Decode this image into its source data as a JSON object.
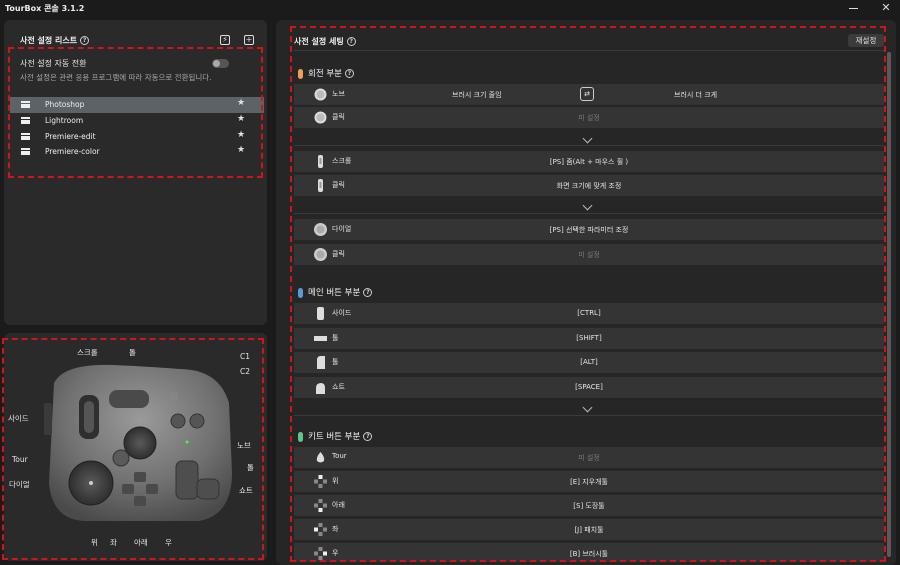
{
  "window": {
    "title": "TourBox 콘솔 3.1.2"
  },
  "presets": {
    "title": "사전 설정 리스트",
    "auto_switch_label": "사전 설정 자동 전환",
    "auto_switch_desc": "사전 설정은 관련 응용 프로그램에 따라 자동으로 전환됩니다.",
    "auto_switch_on": false,
    "items": [
      {
        "name": "Photoshop",
        "selected": true
      },
      {
        "name": "Lightroom",
        "selected": false
      },
      {
        "name": "Premiere-edit",
        "selected": false
      },
      {
        "name": "Premiere-color",
        "selected": false
      }
    ]
  },
  "device_labels": {
    "scroll": "스크롤",
    "tall": "톨",
    "c1": "C1",
    "c2": "C2",
    "side": "사이드",
    "knob": "노브",
    "tour": "Tour",
    "tall2": "톨",
    "dial": "다이얼",
    "short": "쇼트",
    "up": "위",
    "left": "좌",
    "down": "아래",
    "right": "우"
  },
  "settings": {
    "title": "사전 설정 세팅",
    "reset_label": "재설정",
    "sections": {
      "rotation": {
        "label": "회전 부분",
        "color": "#f0a050"
      },
      "main": {
        "label": "메인 버튼 부분",
        "color": "#5b9bd5"
      },
      "kit": {
        "label": "키트 버튼 부분",
        "color": "#5ac98a"
      }
    },
    "rows": {
      "knob": {
        "label": "노브",
        "left": "브러시 크기 줄임",
        "right": "브러시 더 크게"
      },
      "knob_click": {
        "label": "클릭",
        "value": "미 설정"
      },
      "scroll": {
        "label": "스크롤",
        "value": "[PS] 줌(Alt + 마우스 휠 )"
      },
      "scroll_click": {
        "label": "클릭",
        "value": "화면 크기에 맞게 조정"
      },
      "dial": {
        "label": "다이얼",
        "value": "[PS] 선택한 파라미터 조정"
      },
      "dial_click": {
        "label": "클릭",
        "value": "미 설정"
      },
      "side": {
        "label": "사이드",
        "value": "[CTRL]"
      },
      "tall_a": {
        "label": "톨",
        "value": "[SHIFT]"
      },
      "tall_b": {
        "label": "톨",
        "value": "[ALT]"
      },
      "short": {
        "label": "쇼트",
        "value": "[SPACE]"
      },
      "tour": {
        "label": "Tour",
        "value": "미 설정"
      },
      "up": {
        "label": "위",
        "value": "[E] 지우개툴"
      },
      "down": {
        "label": "아래",
        "value": "[S] 도장툴"
      },
      "left": {
        "label": "좌",
        "value": "[J] 패치툴"
      },
      "right": {
        "label": "우",
        "value": "[B] 브러시툴"
      }
    }
  }
}
